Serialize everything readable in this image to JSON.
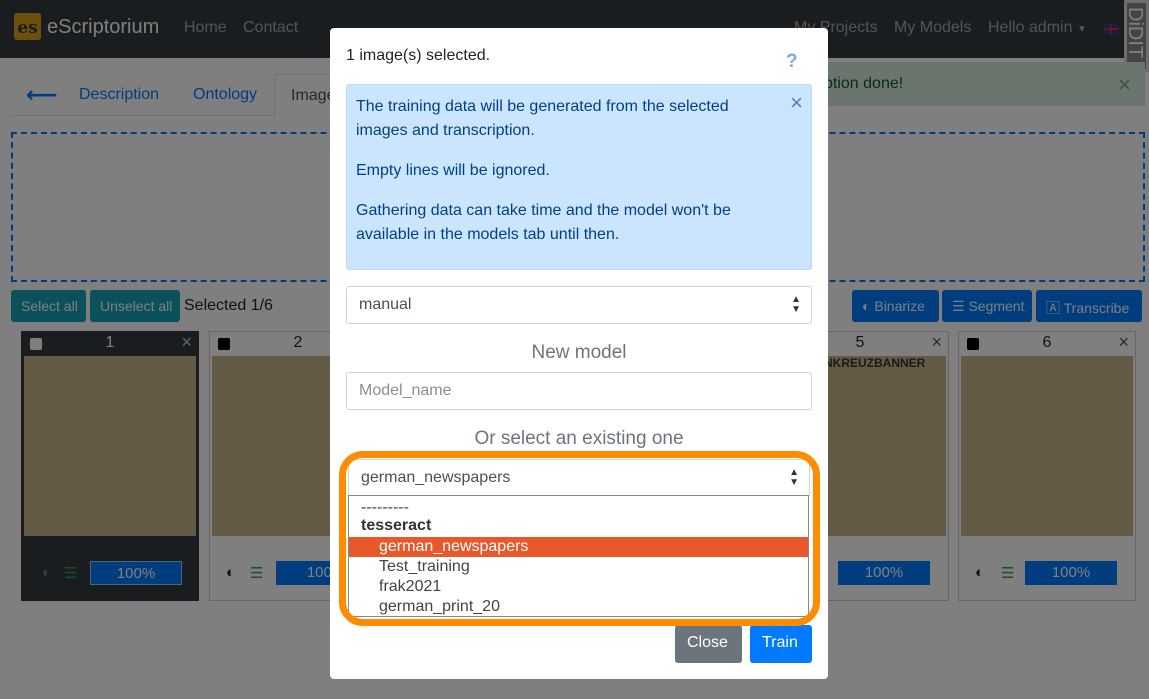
{
  "navbar": {
    "logo": "es",
    "brand": "eScriptorium",
    "links": [
      "Home",
      "Contact"
    ],
    "right_links": [
      "My Projects",
      "My Models",
      "Hello admin"
    ],
    "corner_text": "DiDIT"
  },
  "page": {
    "tabs": [
      "Description",
      "Ontology"
    ],
    "active_tab": "Images",
    "alert_text": "ption done!",
    "buttons": {
      "select_all": "Select all",
      "unselect_all": "Unselect all",
      "binarize": "Binarize",
      "segment": "Segment",
      "transcribe": "Transcribe"
    },
    "selected_text": "Selected 1/6",
    "cards": [
      {
        "num": "1",
        "progress": "100%"
      },
      {
        "num": "2",
        "progress": "100%"
      },
      {
        "num": "5",
        "progress": "100%"
      },
      {
        "num": "6",
        "progress": "100%"
      }
    ],
    "card5_title": "NKREUZBANNER"
  },
  "modal": {
    "title": "1 image(s) selected.",
    "help": "?",
    "info": [
      "The training data will be generated from the selected images and transcription.",
      "Empty lines will be ignored.",
      "Gathering data can take time and the model won't be available in the models tab until then."
    ],
    "transcription_select": "manual",
    "new_model_heading": "New model",
    "model_name_placeholder": "Model_name",
    "existing_heading": "Or select an existing one",
    "model_select": "german_newspapers",
    "options": {
      "blank": "---------",
      "group": "tesseract",
      "items": [
        "german_newspapers",
        "Test_training",
        "frak2021",
        "german_print_20"
      ]
    },
    "close_label": "Close",
    "train_label": "Train"
  },
  "colors": {
    "navbar": "#343a40",
    "primary": "#007bff",
    "teal": "#17a2b8",
    "selected_option": "#e8582a",
    "highlight": "#ff8c00"
  }
}
